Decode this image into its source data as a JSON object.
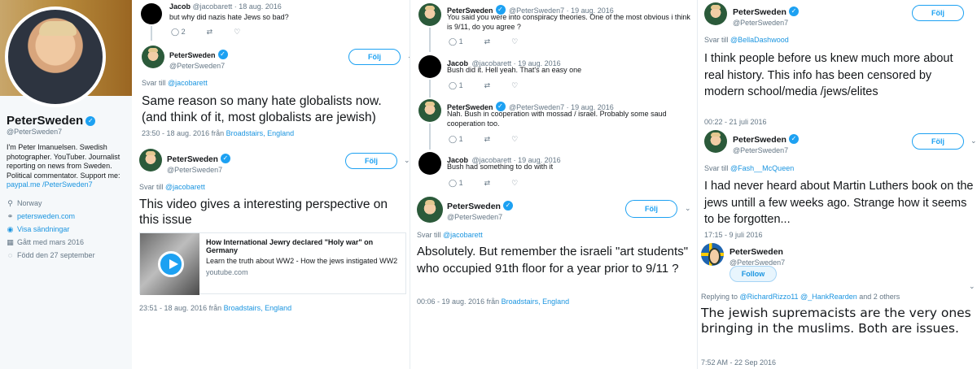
{
  "profile": {
    "name": "PeterSweden",
    "handle": "@PeterSweden7",
    "bio_plain": "I'm Peter Imanuelsen. Swedish photographer. YouTuber. Journalist reporting on news from Sweden. Political commentator. Support me:",
    "bio_link1": "paypal.me",
    "bio_link2": "/PeterSweden7",
    "location": "Norway",
    "website": "petersweden.com",
    "broadcasts": "Visa sändningar",
    "joined": "Gått med mars 2016",
    "born": "Född den 27 september"
  },
  "panel2": {
    "jacob_name": "Jacob",
    "jacob_handle": "@jacobarett · 18 aug. 2016",
    "jacob_text": "but why did nazis hate Jews so bad?",
    "jacob_replies": "2",
    "peter_name": "PeterSweden",
    "peter_handle": "@PeterSweden7",
    "follow": "Följ",
    "reply_to_label": "Svar till",
    "reply_to_user": "@jacobarett",
    "reply_text": "Same reason so many hate globalists now. (and think of it, most globalists are jewish)",
    "reply_time": "23:50 - 18 aug. 2016 från",
    "reply_place": "Broadstairs, England",
    "t2_name": "PeterSweden",
    "t2_handle": "@PeterSweden7",
    "t2_follow": "Följ",
    "t2_reply_label": "Svar till",
    "t2_reply_user": "@jacobarett",
    "t2_text": "This video gives a interesting perspective on this issue",
    "card_title": "How International Jewry declared \"Holy war\" on Germany",
    "card_desc": "Learn the truth about WW2 - How the jews instigated WW2",
    "card_url": "youtube.com",
    "t2_time": "23:51 - 18 aug. 2016 från",
    "t2_place": "Broadstairs, England"
  },
  "panel3": {
    "tweets": [
      {
        "name": "PeterSweden",
        "meta": "@PeterSweden7 · 19 aug. 2016",
        "text": "You said you were into conspiracy theories. One of the most obvious i think is 9/11, do you agree ?",
        "count": "1"
      },
      {
        "name": "Jacob",
        "meta": "@jacobarett · 19 aug. 2016",
        "text": "Bush did it. Hell yeah. That's an easy one",
        "count": "1"
      },
      {
        "name": "PeterSweden",
        "meta": "@PeterSweden7 · 19 aug. 2016",
        "text": "Nah. Bush in cooperation with mossad / israel. Probably some saud cooperation too.",
        "count": "1"
      },
      {
        "name": "Jacob",
        "meta": "@jacobarett · 19 aug. 2016",
        "text": "Bush had something to do with it",
        "count": "1"
      }
    ],
    "main_name": "PeterSweden",
    "main_handle": "@PeterSweden7",
    "follow": "Följ",
    "reply_label": "Svar till",
    "reply_user": "@jacobarett",
    "main_text": "Absolutely. But remember the israeli \"art students\" who occupied 91th floor for a year prior to 9/11 ?",
    "time": "00:06 - 19 aug. 2016 från",
    "place": "Broadstairs, England"
  },
  "panel4": {
    "a_name": "PeterSweden",
    "a_handle": "@PeterSweden7",
    "a_follow": "Följ",
    "a_reply_label": "Svar till",
    "a_reply_user": "@BellaDashwood",
    "a_text": "I think people before us knew much more about real history. This info has been censored by modern school/media /jews/elites",
    "a_time": "00:22 - 21 juli 2016",
    "b_name": "PeterSweden",
    "b_handle": "@PeterSweden7",
    "b_follow": "Följ",
    "b_reply_label": "Svar till",
    "b_reply_user": "@Fash__McQueen",
    "b_text": "I had never heard about Martin Luthers book on the jews untill a few weeks ago. Strange how it seems to be forgotten...",
    "b_time": "17:15 - 9 juli 2016",
    "c_name": "PeterSweden",
    "c_handle": "@PeterSweden7",
    "c_follow": "Follow",
    "c_reply_prefix": "Replying to",
    "c_reply_users": "@RichardRizzo11 @_HankRearden",
    "c_reply_suffix": "and 2 others",
    "c_text": "The jewish supremacists are the very ones bringing in the muslims. Both are issues.",
    "c_time": "7:52 AM - 22 Sep 2016"
  }
}
